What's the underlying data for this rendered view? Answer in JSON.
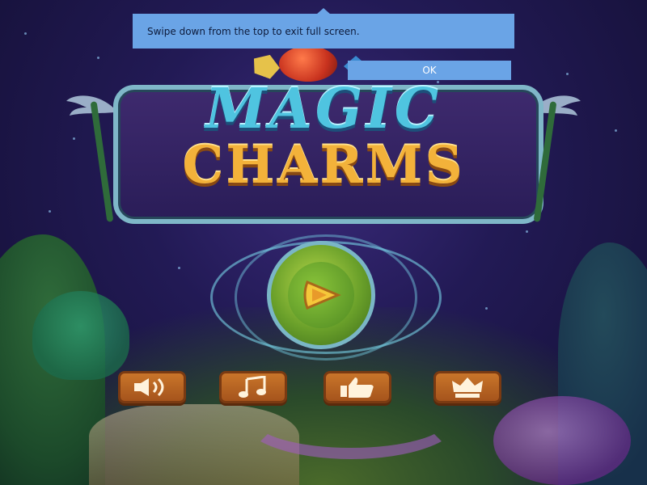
{
  "toast": {
    "message": "Swipe down from the top to exit full screen.",
    "ok_label": "OK",
    "color": "#6aa4e6"
  },
  "logo": {
    "line1": "MAGIC",
    "line2": "CHARMS"
  },
  "buttons": {
    "play_icon": "play-icon",
    "sound_icon": "speaker-icon",
    "music_icon": "music-note-icon",
    "like_icon": "thumbs-up-icon",
    "leaderboard_icon": "crown-icon"
  },
  "colors": {
    "button_orange": "#c9752a",
    "title_blue": "#4fc4e0",
    "title_gold": "#f3b23a",
    "play_green": "#8ac43a"
  }
}
